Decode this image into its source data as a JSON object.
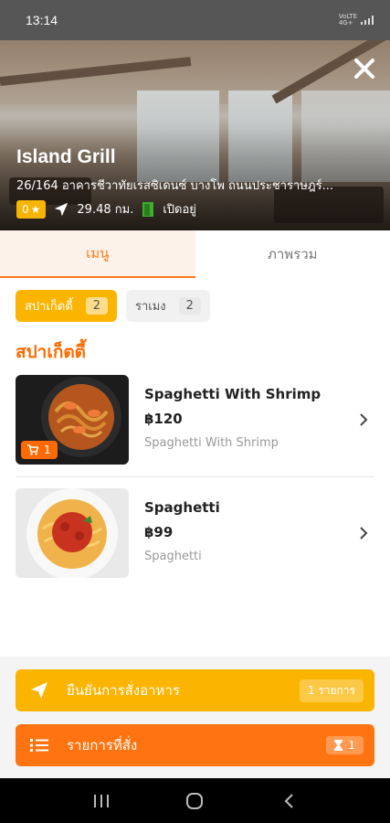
{
  "status_bar": {
    "time": "13:14",
    "network_top": "VoLTE",
    "network_bottom": "4G+"
  },
  "restaurant": {
    "name": "Island Grill",
    "address": "26/164 อาคารชีวาทัยเรสซิเดนซ์ บางโพ  ถนนประชาราษฎร์...",
    "rating": "0",
    "distance": "29.48 กม.",
    "open_status": "เปิดอยู่"
  },
  "tabs": [
    {
      "label": "เมนู",
      "active": true
    },
    {
      "label": "ภาพรวม",
      "active": false
    }
  ],
  "categories": [
    {
      "label": "สปาเก็ตตี้",
      "count": "2",
      "active": true
    },
    {
      "label": "ราเมง",
      "count": "2",
      "active": false
    }
  ],
  "section_title": "สปาเก็ตตี้",
  "menu_items": [
    {
      "name": "Spaghetti With Shrimp",
      "price": "฿120",
      "description": "Spaghetti With Shrimp",
      "cart_count": "1",
      "icon": "shrimp-pasta-photo"
    },
    {
      "name": "Spaghetti",
      "price": "฿99",
      "description": "Spaghetti",
      "icon": "spaghetti-photo"
    }
  ],
  "actions": {
    "confirm_label": "ยืนยันการสั่งอาหาร",
    "confirm_count": "1 รายการ",
    "orders_label": "รายการที่สั่ง",
    "orders_count": "1"
  },
  "colors": {
    "accent_orange": "#ff7410",
    "accent_yellow": "#fbb400",
    "section_title": "#ff6a00"
  }
}
